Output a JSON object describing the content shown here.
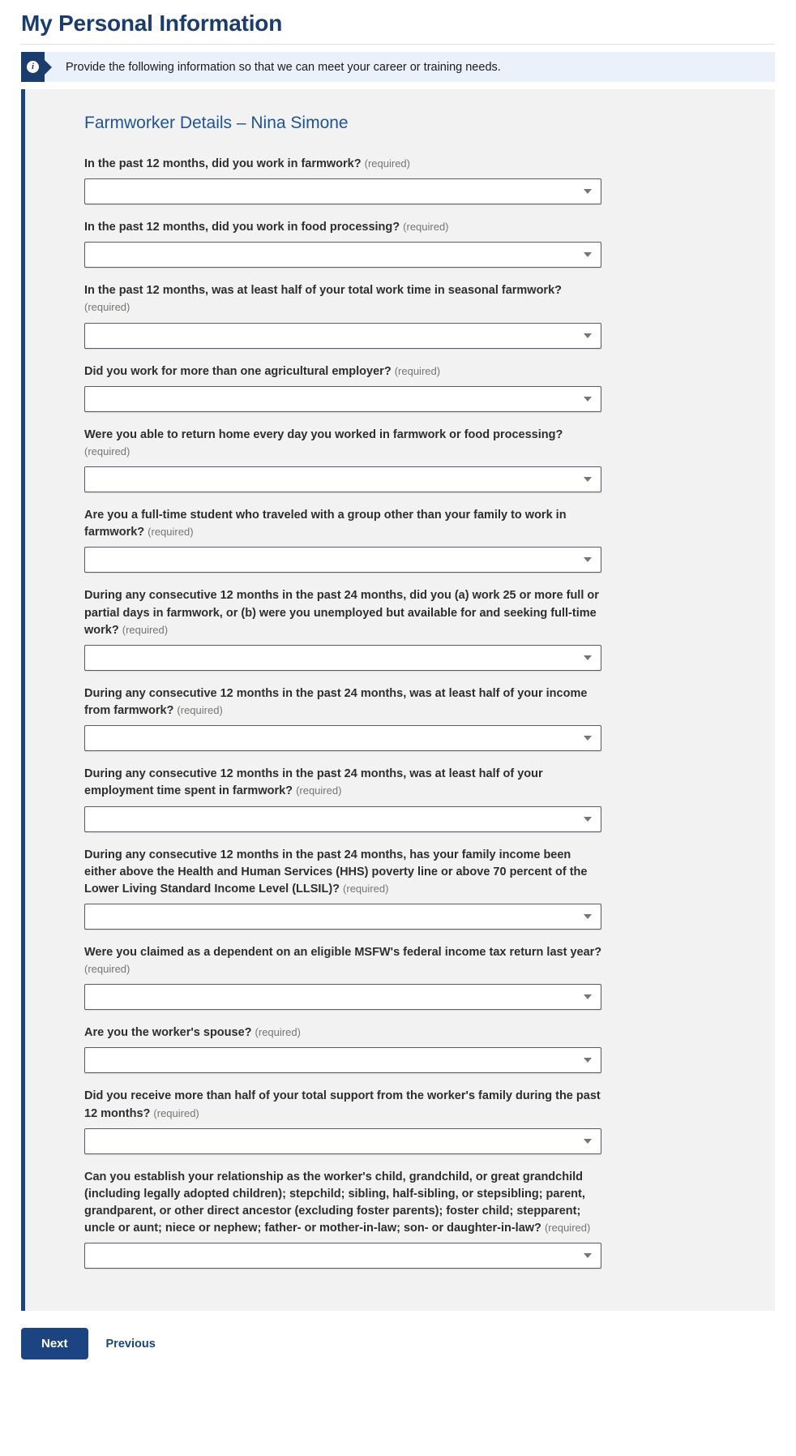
{
  "page": {
    "title": "My Personal Information"
  },
  "alert": {
    "icon": "info-icon",
    "icon_glyph": "i",
    "message": "Provide the following information so that we can meet your career or training needs."
  },
  "form": {
    "section_title": "Farmworker Details – Nina Simone",
    "required_marker": "(required)",
    "fields": [
      {
        "label": "In the past 12 months, did you work in farmwork?",
        "value": ""
      },
      {
        "label": "In the past 12 months, did you work in food processing?",
        "value": ""
      },
      {
        "label": "In the past 12 months, was at least half of your total work time in seasonal farmwork?",
        "value": ""
      },
      {
        "label": "Did you work for more than one agricultural employer?",
        "value": ""
      },
      {
        "label": "Were you able to return home every day you worked in farmwork or food processing?",
        "value": ""
      },
      {
        "label": "Are you a full-time student who traveled with a group other than your family to work in farmwork?",
        "value": ""
      },
      {
        "label": "During any consecutive 12 months in the past 24 months, did you (a) work 25 or more full or partial days in farmwork, or (b) were you unemployed but available for and seeking full-time work?",
        "value": ""
      },
      {
        "label": "During any consecutive 12 months in the past 24 months, was at least half of your income from farmwork?",
        "value": ""
      },
      {
        "label": "During any consecutive 12 months in the past 24 months, was at least half of your employment time spent in farmwork?",
        "value": ""
      },
      {
        "label": "During any consecutive 12 months in the past 24 months, has your family income been either above the Health and Human Services (HHS) poverty line or above 70 percent of the Lower Living Standard Income Level (LLSIL)?",
        "value": ""
      },
      {
        "label": "Were you claimed as a dependent on an eligible MSFW's federal income tax return last year?",
        "value": ""
      },
      {
        "label": "Are you the worker's spouse?",
        "value": ""
      },
      {
        "label": "Did you receive more than half of your total support from the worker's family during the past 12 months?",
        "value": ""
      },
      {
        "label": "Can you establish your relationship as the worker's child, grandchild, or great grandchild (including legally adopted children); stepchild; sibling, half-sibling, or stepsibling; parent, grandparent, or other direct ancestor (excluding foster parents); foster child; stepparent; uncle or aunt; niece or nephew; father- or mother-in-law; son- or daughter-in-law?",
        "value": ""
      }
    ]
  },
  "footer": {
    "next_label": "Next",
    "previous_label": "Previous"
  },
  "colors": {
    "title_navy": "#1b3d6d",
    "panel_border": "#1b4480",
    "section_blue": "#205493",
    "alert_bg": "#eaf1fb",
    "panel_bg": "#f2f2f2"
  }
}
